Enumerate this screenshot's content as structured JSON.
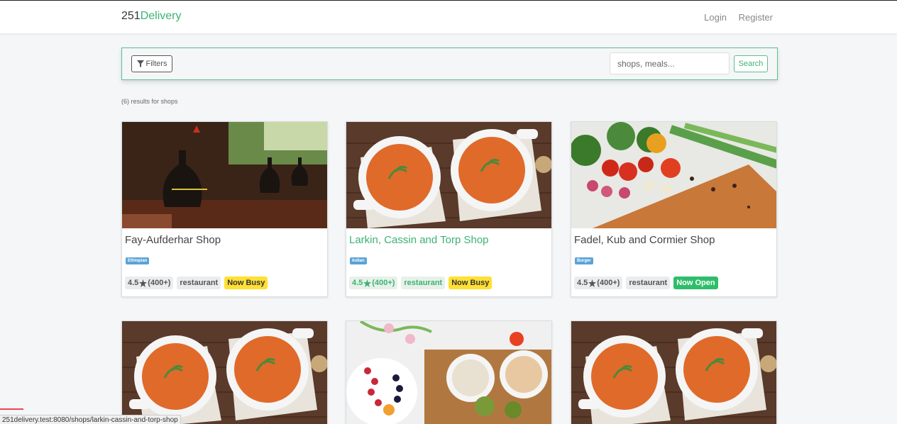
{
  "brand": {
    "number": "251",
    "word": "Delivery"
  },
  "nav": {
    "login": "Login",
    "register": "Register"
  },
  "search": {
    "filters_label": "Filters",
    "placeholder": "shops, meals...",
    "button_label": "Search"
  },
  "results_text": "(6) results for shops",
  "shops": [
    {
      "name": "Fay-Aufderhar Shop",
      "category": "Ethiopian",
      "rating": "4.5",
      "reviews": "(400+)",
      "type": "restaurant",
      "status": "Now Busy"
    },
    {
      "name": "Larkin, Cassin and Torp Shop",
      "category": "Indian",
      "rating": "4.5",
      "reviews": "(400+)",
      "type": "restaurant",
      "status": "Now Busy"
    },
    {
      "name": "Fadel, Kub and Cormier Shop",
      "category": "Burger",
      "rating": "4.5",
      "reviews": "(400+)",
      "type": "restaurant",
      "status": "Now Open"
    }
  ],
  "status_bar_url": "251delivery.test:8080/shops/larkin-cassin-and-torp-shop",
  "colors": {
    "accent": "#3cb371",
    "busy": "#ffe033",
    "open": "#2ebe6a",
    "category": "#5ba3d6"
  }
}
